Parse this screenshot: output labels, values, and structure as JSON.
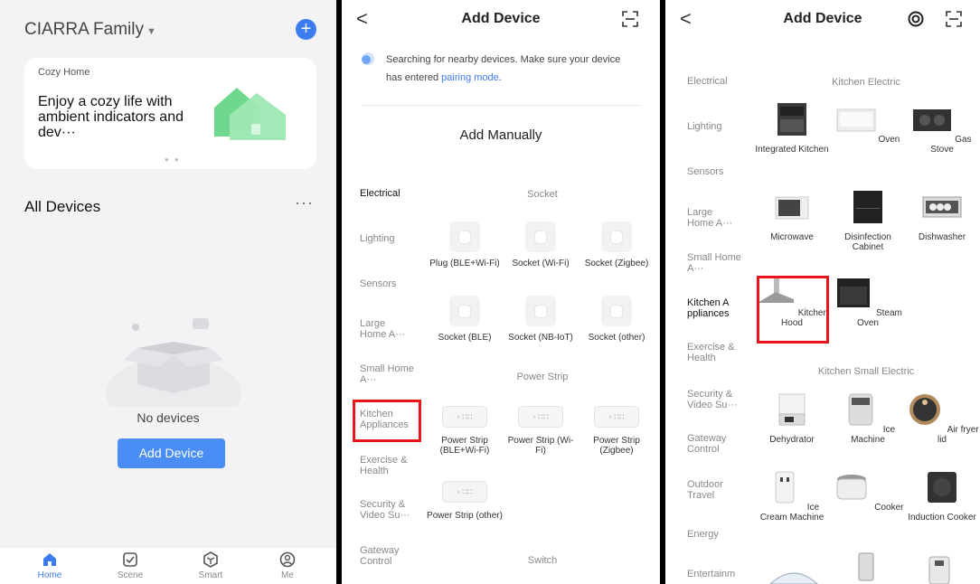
{
  "screen1": {
    "family": "CIARRA Family",
    "caret": "▼",
    "plus": "+",
    "card": {
      "label": "Cozy Home",
      "text": "Enjoy a cozy life with ambient indicators and dev···"
    },
    "all_devices": "All Devices",
    "more": "···",
    "empty_text": "No devices",
    "add_button": "Add Device",
    "tabs": [
      {
        "label": "Home",
        "icon": "home-icon",
        "active": true
      },
      {
        "label": "Scene",
        "icon": "scene-icon"
      },
      {
        "label": "Smart",
        "icon": "smart-icon"
      },
      {
        "label": "Me",
        "icon": "me-icon"
      }
    ],
    "accent": "#3d7cf0"
  },
  "screen2": {
    "back": "<",
    "title": "Add Device",
    "search_text": "Searching for nearby devices. Make sure your device has entered",
    "search_link": "pairing mode",
    "search_end": ".",
    "add_manually": "Add Manually",
    "categories": [
      "Electrical",
      "Lighting",
      "Sensors",
      "Large Home A···",
      "Small Home A···",
      "Kitchen Appliances",
      "Exercise & Health",
      "Security & Video Su···",
      "Gateway Control"
    ],
    "section_socket": "Socket",
    "section_power_strip": "Power Strip",
    "section_switch": "Switch",
    "sockets": [
      "Plug (BLE+Wi-Fi)",
      "Socket (Wi-Fi)",
      "Socket (Zigbee)",
      "Socket (BLE)",
      "Socket (NB-IoT)",
      "Socket (other)"
    ],
    "strips": [
      "Power Strip (BLE+Wi-Fi)",
      "Power Strip (Wi-Fi)",
      "Power Strip (Zigbee)",
      "Power Strip (other)"
    ]
  },
  "screen3": {
    "back": "<",
    "title": "Add Device",
    "categories": [
      "Electrical",
      "Lighting",
      "Sensors",
      "Large Home A···",
      "Small Home A···",
      "Kitchen A ppliances",
      "Exercise & Health",
      "Security & Video Su···",
      "Gateway Control",
      "Outdoor Travel",
      "Energy",
      "Entertainm"
    ],
    "section_kitchen_electric": "Kitchen Electric",
    "section_kitchen_small": "Kitchen Small Electric",
    "kitchen_electric": [
      "Integrated Kitchen",
      "Oven",
      "Gas Stove",
      "Microwave",
      "Disinfection Cabinet",
      "Dishwasher",
      "Kitchen Hood",
      "Steam Oven"
    ],
    "kitchen_small": [
      "Dehydrator",
      "Ice Machine",
      "Air fryer lid",
      "Ice Cream Machine",
      "Cooker",
      "Induction Cooker"
    ]
  }
}
